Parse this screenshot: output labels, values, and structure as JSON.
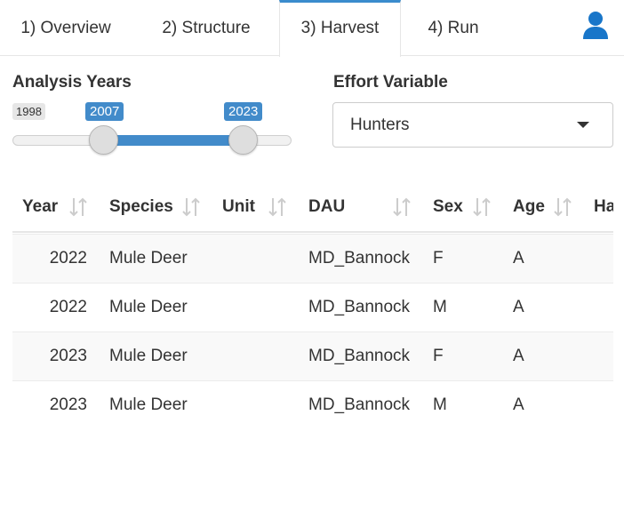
{
  "tabs": [
    {
      "label": "1) Overview"
    },
    {
      "label": "2) Structure"
    },
    {
      "label": "3) Harvest"
    },
    {
      "label": "4) Run"
    }
  ],
  "active_tab": "3) Harvest",
  "user_icon": "user-icon",
  "analysis_years": {
    "label": "Analysis Years",
    "min_label": "1998",
    "from": "2007",
    "to": "2023"
  },
  "effort_variable": {
    "label": "Effort Variable",
    "value": "Hunters"
  },
  "table": {
    "columns": [
      "Year",
      "Species",
      "Unit",
      "DAU",
      "Sex",
      "Age",
      "Ha"
    ],
    "rows": [
      {
        "year": "2022",
        "species": "Mule Deer",
        "unit": "",
        "dau": "MD_Bannock",
        "sex": "F",
        "age": "A"
      },
      {
        "year": "2022",
        "species": "Mule Deer",
        "unit": "",
        "dau": "MD_Bannock",
        "sex": "M",
        "age": "A"
      },
      {
        "year": "2023",
        "species": "Mule Deer",
        "unit": "",
        "dau": "MD_Bannock",
        "sex": "F",
        "age": "A"
      },
      {
        "year": "2023",
        "species": "Mule Deer",
        "unit": "",
        "dau": "MD_Bannock",
        "sex": "M",
        "age": "A"
      }
    ]
  },
  "colors": {
    "accent": "#3a8ccd",
    "slider": "#428bca"
  }
}
